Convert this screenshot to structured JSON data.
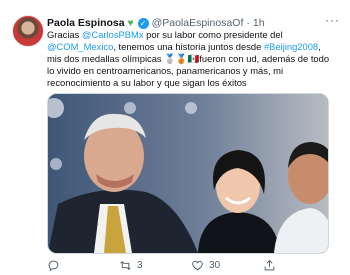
{
  "tweet": {
    "author_name": "Paola Espinosa",
    "handle": "@PaolaEspinosaOf",
    "separator": "·",
    "time": "1h",
    "more_icon": "more-dots-icon",
    "text": {
      "p1": "Gracias ",
      "m1": "@CarlosPBMx",
      "p2": " por su labor como presidente del ",
      "m2": "@COM_Mexico",
      "p3": ", tenemos una historia juntos desde ",
      "h1": "#Beijing2008",
      "p4": ", mis dos medallas olímpicas ",
      "medals": "🥈🥉",
      "flag": "🇲🇽",
      "p5": "fueron con ud, además de todo lo vivido en centroamericanos, panamericanos y más, mi reconocimiento a su labor y que sigan los éxitos"
    },
    "photo_icon": "photo-icon",
    "actions": {
      "reply_count": "",
      "retweet_count": "3",
      "like_count": "30",
      "share_count": ""
    }
  },
  "colors": {
    "link": "#1d9bf0",
    "secondary": "#536471",
    "verified_badge": "#1d9bf0",
    "heart_emoji": "#45b649"
  }
}
